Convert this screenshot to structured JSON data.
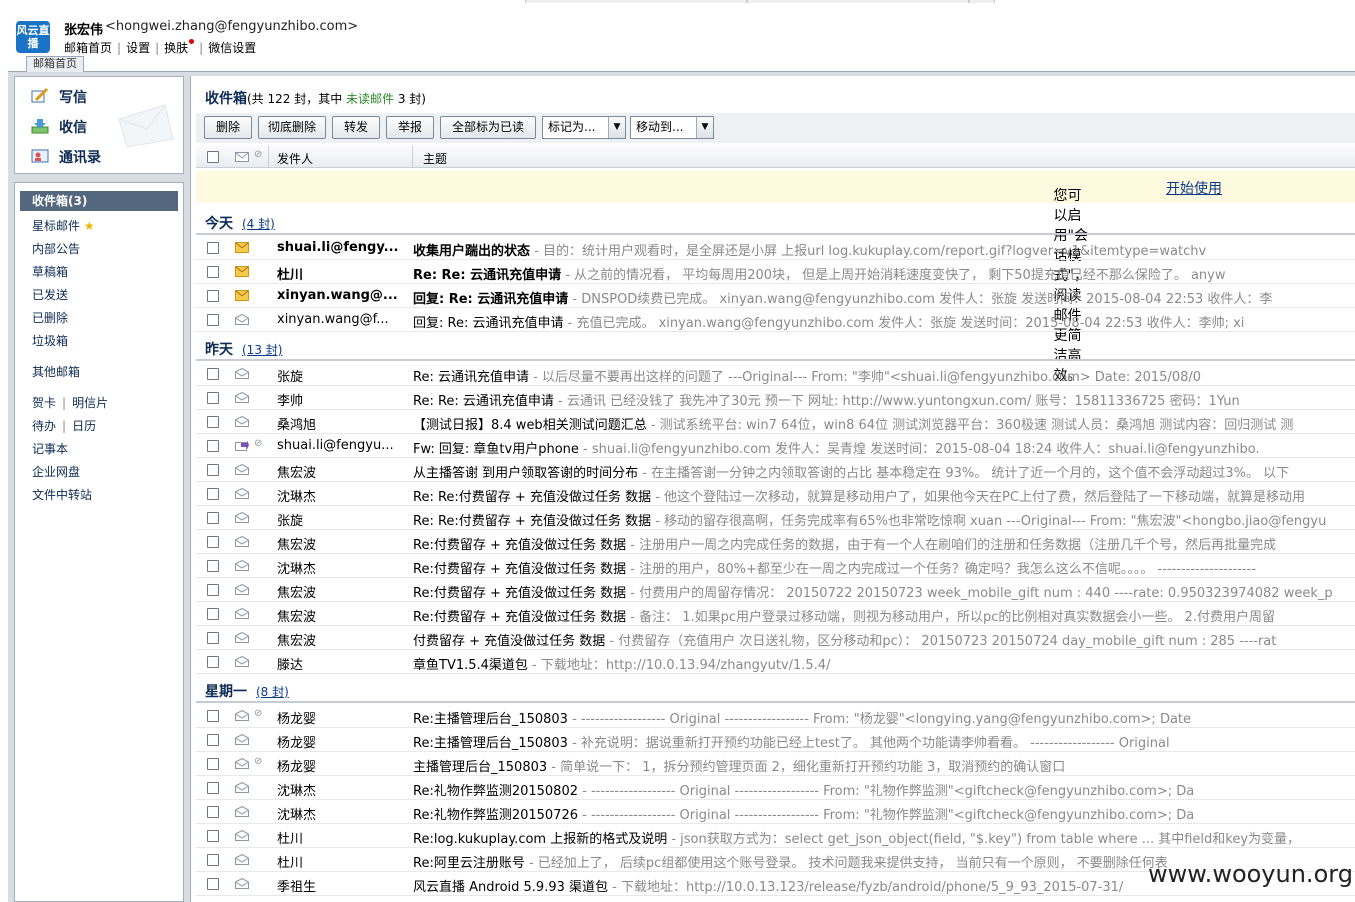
{
  "header": {
    "logo_text": "风云直播",
    "user_name": "张宏伟",
    "user_email": "<hongwei.zhang@fengyunzhibo.com>",
    "links": [
      "邮箱首页",
      "设置",
      "换肤",
      "微信设置"
    ],
    "home_tab": "邮箱首页"
  },
  "sidebar": {
    "compose": "写信",
    "receive": "收信",
    "contacts": "通讯录",
    "inbox": "收件箱(3)",
    "items": [
      "星标邮件",
      "内部公告",
      "草稿箱",
      "已发送",
      "已删除",
      "垃圾箱"
    ],
    "other_mail": "其他邮箱",
    "tools_row1": [
      "贺卡",
      "明信片"
    ],
    "tools_row2": [
      "待办",
      "日历"
    ],
    "tools_more": [
      "记事本",
      "企业网盘",
      "文件中转站"
    ]
  },
  "main": {
    "title": "收件箱",
    "count_prefix": "(共 122 封，其中 ",
    "unread_text": "未读邮件",
    "count_suffix": " 3 封)",
    "toolbar": {
      "delete": "删除",
      "delete_perm": "彻底删除",
      "forward": "转发",
      "report": "举报",
      "mark_all_read": "全部标为已读",
      "mark_as": "标记为...",
      "move_to": "移动到..."
    },
    "columns": {
      "from": "发件人",
      "subject": "主题"
    },
    "notice": "您可以启用\"会话模式\"，阅读邮件更简洁高效。",
    "notice_link": "开始使用"
  },
  "groups": [
    {
      "label": "今天",
      "count": "(4 封)"
    },
    {
      "label": "昨天",
      "count": "(13 封)"
    },
    {
      "label": "星期一",
      "count": "(8 封)"
    }
  ],
  "emails": [
    {
      "from": "shuai.li@fengy...",
      "subject": "收集用户踹出的状态",
      "preview": " - 目的：统计用户观看时，是全屏还是小屏 上报url log.kukuplay.com/report.gif?logver=v1&itemtype=watchv",
      "unread": true,
      "icon": "unread-mail-icon",
      "attach": false
    },
    {
      "from": "杜川",
      "subject": "Re: Re: 云通讯充值申请",
      "preview": " - 从之前的情况看， 平均每周用200块， 但是上周开始消耗速度变快了， 剩下50提充值已经不那么保险了。 anyw",
      "unread": true,
      "icon": "unread-mail-icon",
      "attach": false
    },
    {
      "from": "xinyan.wang@...",
      "subject": "回复: Re: 云通讯充值申请",
      "preview": " - DNSPOD续费已完成。 xinyan.wang@fengyunzhibo.com 发件人：张旋 发送时间：2015-08-04 22:53 收件人：李",
      "unread": true,
      "icon": "unread-mail-icon",
      "attach": false
    },
    {
      "from": "xinyan.wang@f...",
      "subject": "回复: Re: 云通讯充值申请",
      "preview": " - 充值已完成。 xinyan.wang@fengyunzhibo.com 发件人：张旋 发送时间：2015-08-04 22:53 收件人：李帅; xi",
      "unread": false,
      "icon": "read-mail-icon",
      "attach": false
    },
    {
      "from": "张旋",
      "subject": "Re: 云通讯充值申请",
      "preview": " - 以后尽量不要再出这样的问题了 ---Original--- From: \"李帅\"<shuai.li@fengyunzhibo.com> Date: 2015/08/0",
      "unread": false,
      "icon": "read-mail-icon",
      "attach": false
    },
    {
      "from": "李帅",
      "subject": "Re: Re: 云通讯充值申请",
      "preview": " - 云通讯 已经没钱了 我先冲了30元 预一下 网址: http://www.yuntongxun.com/ 账号：15811336725 密码：1Yun",
      "unread": false,
      "icon": "read-mail-icon",
      "attach": false
    },
    {
      "from": "桑鸿旭",
      "subject": "【测试日报】8.4 web相关测试问题汇总",
      "preview": " - 测试系统平台: win7 64位，win8 64位 测试浏览器平台：360极速 测试人员：桑鸿旭 测试内容：回归测试 测",
      "unread": false,
      "icon": "read-mail-icon",
      "attach": false
    },
    {
      "from": "shuai.li@fengyu...",
      "subject": "Fw: 回复: 章鱼tv用户phone",
      "preview": " - shuai.li@fengyunzhibo.com 发件人：吴青煌 发送时间：2015-08-04 18:24 收件人：shuai.li@fengyunzhibo.",
      "unread": false,
      "icon": "forwarded-mail-icon",
      "attach": true
    },
    {
      "from": "焦宏波",
      "subject": "从主播答谢 到用户领取答谢的时间分布",
      "preview": " - 在主播答谢一分钟之内领取答谢的占比 基本稳定在 93%。 统计了近一个月的，这个值不会浮动超过3%。 以下",
      "unread": false,
      "icon": "read-mail-icon",
      "attach": false
    },
    {
      "from": "沈琳杰",
      "subject": "Re: Re:付费留存 + 充值没做过任务 数据",
      "preview": " - 他这个登陆过一次移动，就算是移动用户了，如果他今天在PC上付了费，然后登陆了一下移动端，就算是移动用",
      "unread": false,
      "icon": "read-mail-icon",
      "attach": false
    },
    {
      "from": "张旋",
      "subject": "Re: Re:付费留存 + 充值没做过任务 数据",
      "preview": " - 移动的留存很高啊，任务完成率有65%也非常吃惊啊 xuan ---Original--- From: \"焦宏波\"<hongbo.jiao@fengyu",
      "unread": false,
      "icon": "read-mail-icon",
      "attach": false
    },
    {
      "from": "焦宏波",
      "subject": "Re:付费留存 + 充值没做过任务 数据",
      "preview": " - 注册用户一周之内完成任务的数据，由于有一个人在刷咱们的注册和任务数据（注册几千个号，然后再批量完成",
      "unread": false,
      "icon": "read-mail-icon",
      "attach": false
    },
    {
      "from": "沈琳杰",
      "subject": "Re:付费留存 + 充值没做过任务 数据",
      "preview": " - 注册的用户，80%+都至少在一周之内完成过一个任务？确定吗？我怎么这么不信呢。。。。 ---------------------",
      "unread": false,
      "icon": "read-mail-icon",
      "attach": false
    },
    {
      "from": "焦宏波",
      "subject": "Re:付费留存 + 充值没做过任务 数据",
      "preview": " - 付费用户的周留存情况： 20150722 20150723 week_mobile_gift num : 440 ----rate: 0.950323974082 week_p",
      "unread": false,
      "icon": "read-mail-icon",
      "attach": false
    },
    {
      "from": "焦宏波",
      "subject": "Re:付费留存 + 充值没做过任务 数据",
      "preview": " - 备注： 1.如果pc用户登录过移动端，则视为移动用户，所以pc的比例相对真实数据会小一些。 2.付费用户周留",
      "unread": false,
      "icon": "read-mail-icon",
      "attach": false
    },
    {
      "from": "焦宏波",
      "subject": "付费留存 + 充值没做过任务 数据",
      "preview": " - 付费留存（充值用户 次日送礼物，区分移动和pc）： 20150723 20150724 day_mobile_gift num : 285 ----rat",
      "unread": false,
      "icon": "read-mail-icon",
      "attach": false
    },
    {
      "from": "滕达",
      "subject": "章鱼TV1.5.4渠道包",
      "preview": " - 下载地址：http://10.0.13.94/zhangyutv/1.5.4/",
      "unread": false,
      "icon": "read-mail-icon",
      "attach": false
    },
    {
      "from": "杨龙婴",
      "subject": "Re:主播管理后台_150803",
      "preview": " - ------------------ Original ------------------ From: \"杨龙婴\"<longying.yang@fengyunzhibo.com>; Date",
      "unread": false,
      "icon": "read-mail-icon",
      "attach": true
    },
    {
      "from": "杨龙婴",
      "subject": "Re:主播管理后台_150803",
      "preview": " - 补充说明：据说重新打开预约功能已经上test了。 其他两个功能请李帅看看。 ------------------ Original",
      "unread": false,
      "icon": "read-mail-icon",
      "attach": false
    },
    {
      "from": "杨龙婴",
      "subject": "主播管理后台_150803",
      "preview": " - 简单说一下： 1，拆分预约管理页面 2，细化重新打开预约功能 3，取消预约的确认窗口",
      "unread": false,
      "icon": "read-mail-icon",
      "attach": true
    },
    {
      "from": "沈琳杰",
      "subject": "Re:礼物作弊监测20150802",
      "preview": " - ------------------ Original ------------------ From: \"礼物作弊监测\"<giftcheck@fengyunzhibo.com>; Da",
      "unread": false,
      "icon": "read-mail-icon",
      "attach": false
    },
    {
      "from": "沈琳杰",
      "subject": "Re:礼物作弊监测20150726",
      "preview": " - ------------------ Original ------------------ From: \"礼物作弊监测\"<giftcheck@fengyunzhibo.com>; Da",
      "unread": false,
      "icon": "read-mail-icon",
      "attach": false
    },
    {
      "from": "杜川",
      "subject": "Re:log.kukuplay.com 上报新的格式及说明",
      "preview": " - json获取方式为：select get_json_object(field, \"$.key\") from table where ... 其中field和key为变量，",
      "unread": false,
      "icon": "read-mail-icon",
      "attach": false
    },
    {
      "from": "杜川",
      "subject": "Re:阿里云注册账号",
      "preview": " - 已经加上了， 后续pc组都使用这个账号登录。 技术问题我来提供支持， 当前只有一个原则， 不要删除任何表",
      "unread": false,
      "icon": "read-mail-icon",
      "attach": false
    },
    {
      "from": "季祖生",
      "subject": "风云直播 Android 5.9.93 渠道包",
      "preview": " - 下载地址：http://10.0.13.123/release/fyzb/android/phone/5_9_93_2015-07-31/",
      "unread": false,
      "icon": "read-mail-icon",
      "attach": false
    }
  ],
  "watermark": "www.wooyun.org"
}
